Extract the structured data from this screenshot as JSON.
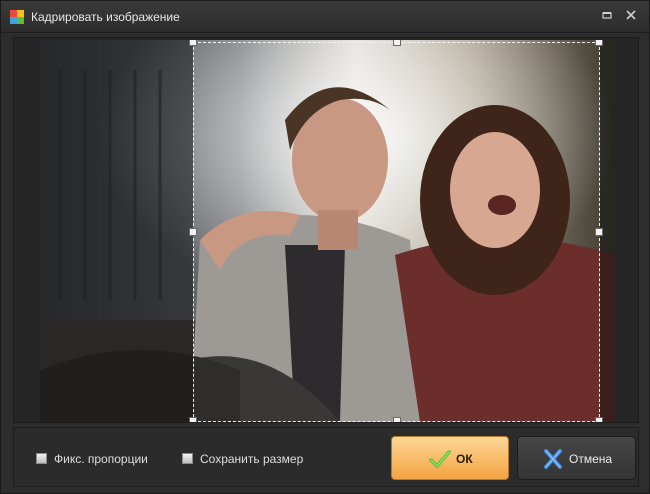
{
  "window": {
    "title": "Кадрировать изображение",
    "minimize_glyph": "▭",
    "close_glyph": "✕"
  },
  "image": {
    "description_icon": "photo-couple-laughing"
  },
  "options": {
    "fix_proportions_label": "Фикс. пропорции",
    "fix_proportions_checked": false,
    "keep_size_label": "Сохранить размер",
    "keep_size_checked": false
  },
  "buttons": {
    "ok_label": "ОК",
    "cancel_label": "Отмена"
  },
  "colors": {
    "ok_accent": "#f2a341",
    "ok_check": "#5cc23a",
    "cancel_x": "#3d8ee6"
  }
}
